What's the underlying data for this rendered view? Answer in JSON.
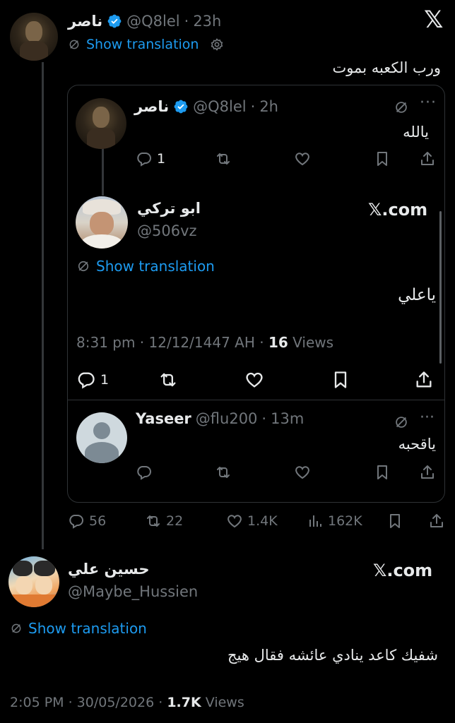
{
  "top_tweet": {
    "name": "ناصر",
    "handle": "@Q8lel",
    "dot": "·",
    "time": "23h",
    "show_translation": "Show translation",
    "text": "ورب الكعبه بموت",
    "x_logo": "𝕏"
  },
  "quote_tweet": {
    "name": "ناصر",
    "handle": "@Q8lel",
    "dot": "·",
    "time": "2h",
    "text": "يالله",
    "reply_count": "1"
  },
  "embedded_tweet": {
    "name": "ابو تركي",
    "handle": "@506vz",
    "xcom": "𝕏.com",
    "show_translation": "Show translation",
    "text": "ياعلي",
    "timestamp": "8:31 pm · 12/12/1447 AH ·",
    "views_count": "16",
    "views_label": "Views",
    "reply_count": "1"
  },
  "reply_tweet": {
    "name": "Yaseer",
    "handle": "@flu200",
    "dot": "·",
    "time": "13m",
    "text": "ياقحبه"
  },
  "top_actions": {
    "replies": "56",
    "reposts": "22",
    "likes": "1.4K",
    "views": "162K"
  },
  "main_tweet": {
    "name": "حسين علي",
    "handle": "@Maybe_Hussien",
    "xcom": "𝕏.com",
    "show_translation": "Show translation",
    "text": "شفيك كاعد ينادي عائشه فقال هيج",
    "timestamp": "2:05 PM · 30/05/2026 ·",
    "views_count": "1.7K",
    "views_label": "Views"
  },
  "colors": {
    "background": "#000000",
    "text": "#e7e9ea",
    "secondary": "#71767b",
    "accent": "#1d9bf0",
    "border": "#2f3336"
  },
  "icons": [
    "x-logo-icon",
    "verified-badge-icon",
    "translate-icon",
    "gear-icon",
    "reply-icon",
    "repost-icon",
    "like-icon",
    "bookmark-icon",
    "share-icon",
    "views-icon",
    "more-icon"
  ]
}
